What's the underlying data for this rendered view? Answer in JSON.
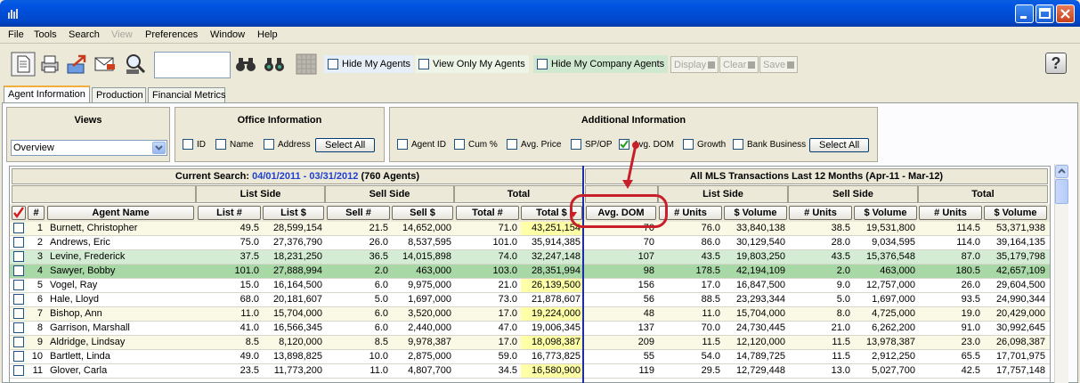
{
  "window": {
    "title": ""
  },
  "menu": [
    {
      "label": "File",
      "enabled": true
    },
    {
      "label": "Tools",
      "enabled": true
    },
    {
      "label": "Search",
      "enabled": true
    },
    {
      "label": "View",
      "enabled": false
    },
    {
      "label": "Preferences",
      "enabled": true
    },
    {
      "label": "Window",
      "enabled": true
    },
    {
      "label": "Help",
      "enabled": true
    }
  ],
  "toolbar": {
    "icons": [
      "new-document-icon",
      "print-icon",
      "export-icon",
      "email-icon",
      "search-agent-icon",
      "binoculars-icon",
      "binoculars-group-icon",
      "grid-icon"
    ],
    "search_value": "",
    "hide_my_agents": "Hide My Agents",
    "view_only_my_agents": "View Only My Agents",
    "hide_my_company_agents": "Hide My Company Agents",
    "display_label": "Display",
    "clear_label": "Clear",
    "save_label": "Save",
    "help_label": "?"
  },
  "tabs": [
    "Agent Information",
    "Production",
    "Financial Metrics"
  ],
  "views": {
    "title": "Views",
    "selected": "Overview"
  },
  "office": {
    "title": "Office Information",
    "options": [
      "ID",
      "Name",
      "Address"
    ],
    "select_all": "Select All"
  },
  "additional": {
    "title": "Additional Information",
    "options": [
      {
        "label": "Agent ID",
        "checked": false
      },
      {
        "label": "Cum %",
        "checked": false
      },
      {
        "label": "Avg. Price",
        "checked": false
      },
      {
        "label": "SP/OP",
        "checked": false
      },
      {
        "label": "Avg. DOM",
        "checked": true
      },
      {
        "label": "Growth",
        "checked": false
      },
      {
        "label": "Bank Business",
        "checked": false
      }
    ],
    "select_all": "Select All"
  },
  "grid": {
    "current_search_label": "Current Search:",
    "current_search_range": "04/01/2011 - 03/31/2012",
    "current_search_count": "(760 Agents)",
    "mls_header": "All MLS Transactions Last 12 Months (Apr-11 - Mar-12)",
    "left_groups": [
      "List Side",
      "Sell Side",
      "Total"
    ],
    "right_groups": [
      "List Side",
      "Sell Side",
      "Total"
    ],
    "left_columns": [
      "#",
      "Agent Name",
      "List #",
      "List $",
      "Sell #",
      "Sell $",
      "Total #",
      "Total $"
    ],
    "right_columns": [
      "Avg. DOM",
      "# Units",
      "$ Volume",
      "# Units",
      "$ Volume",
      "# Units",
      "$ Volume"
    ],
    "rows": [
      [
        "1",
        "Burnett, Christopher",
        "49.5",
        "28,599,154",
        "21.5",
        "14,652,000",
        "71.0",
        "43,251,154",
        "70",
        "76.0",
        "33,840,138",
        "38.5",
        "19,531,800",
        "114.5",
        "53,371,938"
      ],
      [
        "2",
        "Andrews, Eric",
        "75.0",
        "27,376,790",
        "26.0",
        "8,537,595",
        "101.0",
        "35,914,385",
        "70",
        "86.0",
        "30,129,540",
        "28.0",
        "9,034,595",
        "114.0",
        "39,164,135"
      ],
      [
        "3",
        "Levine, Frederick",
        "37.5",
        "18,231,250",
        "36.5",
        "14,015,898",
        "74.0",
        "32,247,148",
        "107",
        "43.5",
        "19,803,250",
        "43.5",
        "15,376,548",
        "87.0",
        "35,179,798"
      ],
      [
        "4",
        "Sawyer, Bobby",
        "101.0",
        "27,888,994",
        "2.0",
        "463,000",
        "103.0",
        "28,351,994",
        "98",
        "178.5",
        "42,194,109",
        "2.0",
        "463,000",
        "180.5",
        "42,657,109"
      ],
      [
        "5",
        "Vogel, Ray",
        "15.0",
        "16,164,500",
        "6.0",
        "9,975,000",
        "21.0",
        "26,139,500",
        "156",
        "17.0",
        "16,847,500",
        "9.0",
        "12,757,000",
        "26.0",
        "29,604,500"
      ],
      [
        "6",
        "Hale, Lloyd",
        "68.0",
        "20,181,607",
        "5.0",
        "1,697,000",
        "73.0",
        "21,878,607",
        "56",
        "88.5",
        "23,293,344",
        "5.0",
        "1,697,000",
        "93.5",
        "24,990,344"
      ],
      [
        "7",
        "Bishop, Ann",
        "11.0",
        "15,704,000",
        "6.0",
        "3,520,000",
        "17.0",
        "19,224,000",
        "48",
        "11.0",
        "15,704,000",
        "8.0",
        "4,725,000",
        "19.0",
        "20,429,000"
      ],
      [
        "8",
        "Garrison, Marshall",
        "41.0",
        "16,566,345",
        "6.0",
        "2,440,000",
        "47.0",
        "19,006,345",
        "137",
        "70.0",
        "24,730,445",
        "21.0",
        "6,262,200",
        "91.0",
        "30,992,645"
      ],
      [
        "9",
        "Aldridge, Lindsay",
        "8.5",
        "8,120,000",
        "8.5",
        "9,978,387",
        "17.0",
        "18,098,387",
        "209",
        "11.5",
        "12,120,000",
        "11.5",
        "13,978,387",
        "23.0",
        "26,098,387"
      ],
      [
        "10",
        "Bartlett, Linda",
        "49.0",
        "13,898,825",
        "10.0",
        "2,875,000",
        "59.0",
        "16,773,825",
        "55",
        "54.0",
        "14,789,725",
        "11.5",
        "2,912,250",
        "65.5",
        "17,701,975"
      ],
      [
        "11",
        "Glover, Carla",
        "23.5",
        "11,773,200",
        "11.0",
        "4,807,700",
        "34.5",
        "16,580,900",
        "119",
        "29.5",
        "12,729,448",
        "13.0",
        "5,027,700",
        "42.5",
        "17,757,148"
      ]
    ],
    "row_styles": [
      "alt",
      "",
      "g1",
      "g2",
      "",
      "",
      "alt",
      "",
      "alt",
      "",
      ""
    ],
    "highlight_total_rows": [
      0,
      4,
      6,
      8,
      10
    ]
  },
  "colors": {
    "accent": "#0054e3",
    "highlight": "#ffffa8",
    "annotation": "#c8202a",
    "divider": "#1b2ea8"
  }
}
